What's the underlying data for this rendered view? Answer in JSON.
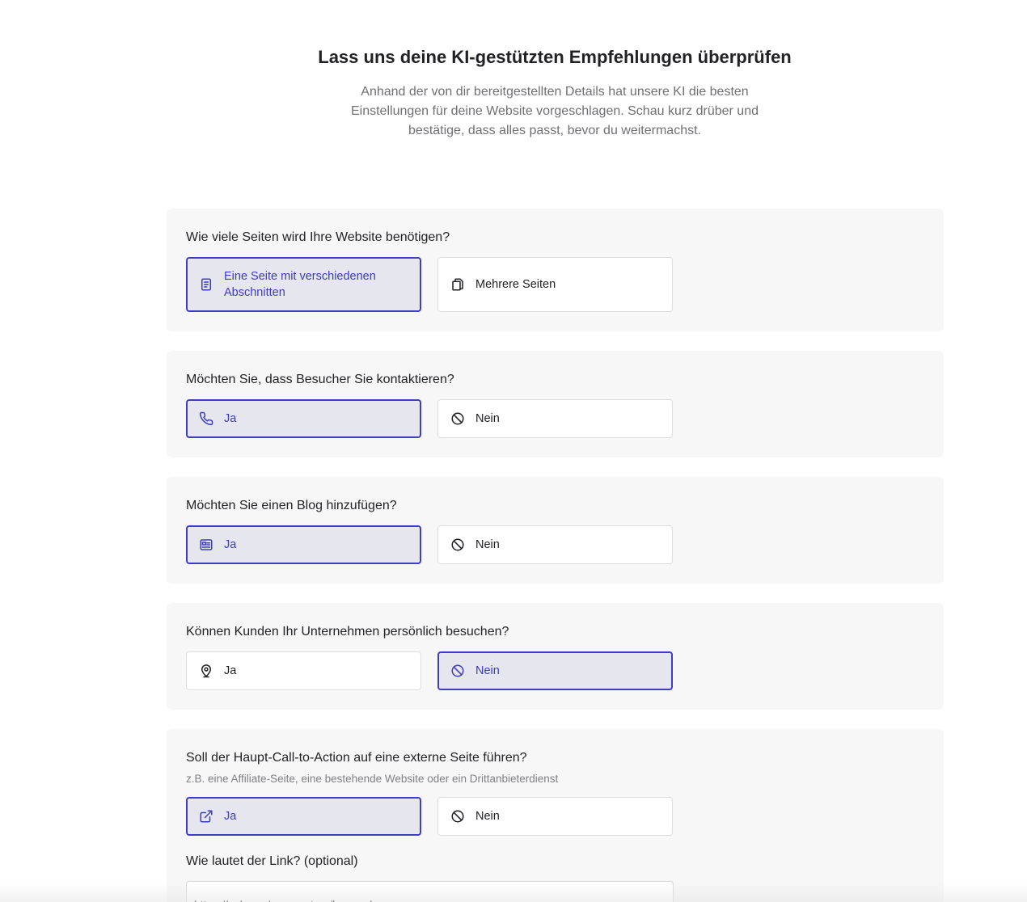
{
  "header": {
    "title": "Lass uns deine KI-gestützten Empfehlungen überprüfen",
    "subtitle": "Anhand der von dir bereitgestellten Details hat unsere KI die besten Einstellungen für deine Website vorgeschlagen. Schau kurz drüber und bestätige, dass alles passt, bevor du weitermachst."
  },
  "q1": {
    "question": "Wie viele Seiten wird Ihre Website benötigen?",
    "option_a": "Eine Seite mit verschiedenen Abschnitten",
    "option_b": "Mehrere Seiten",
    "selected": "option_a"
  },
  "q2": {
    "question": "Möchten Sie, dass Besucher Sie kontaktieren?",
    "option_a": "Ja",
    "option_b": "Nein",
    "selected": "option_a"
  },
  "q3": {
    "question": "Möchten Sie einen Blog hinzufügen?",
    "option_a": "Ja",
    "option_b": "Nein",
    "selected": "option_a"
  },
  "q4": {
    "question": "Können Kunden Ihr Unternehmen persönlich besuchen?",
    "option_a": "Ja",
    "option_b": "Nein",
    "selected": "option_b"
  },
  "q5": {
    "question": "Soll der Haupt-Call-to-Action auf eine externe Seite führen?",
    "hint": "z.B. eine Affiliate-Seite, eine bestehende Website oder ein Drittanbieterdienst",
    "option_a": "Ja",
    "option_b": "Nein",
    "selected": "option_a",
    "link_label": "Wie lautet der Link? (optional)",
    "link_value": "https://cal.com/evomentum/kennenlernen"
  },
  "icons": {
    "q1_a": "document-icon",
    "q1_b": "copy-pages-icon",
    "q2_a": "phone-icon",
    "q2_b": "ban-icon",
    "q3_a": "newspaper-icon",
    "q3_b": "ban-icon",
    "q4_a": "map-pin-icon",
    "q4_b": "ban-icon",
    "q5_a": "external-link-icon",
    "q5_b": "ban-icon"
  },
  "colors": {
    "accent": "#3d3ec2",
    "selected_bg": "#e6e6ef",
    "card_bg": "#f7f7f7"
  }
}
